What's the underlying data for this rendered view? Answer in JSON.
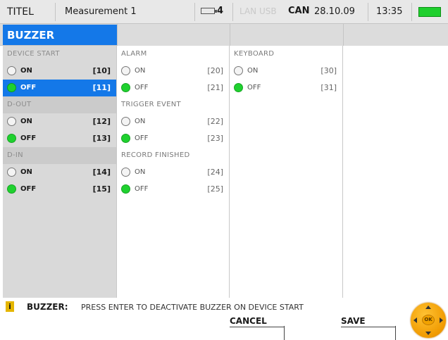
{
  "status_bar": {
    "titel": "TITEL",
    "measurement": "Measurement 1",
    "battery_count": "4",
    "lan_usb": "LAN USB",
    "can": "CAN",
    "date": "28.10.09",
    "time": "13:35"
  },
  "header": {
    "title": "BUZZER"
  },
  "columns": [
    {
      "sections": [
        {
          "title": "DEVICE START",
          "options": [
            {
              "label": "ON",
              "code": "[10]",
              "checked": false
            },
            {
              "label": "OFF",
              "code": "[11]",
              "checked": true,
              "selected": true
            }
          ]
        },
        {
          "title": "D-OUT",
          "options": [
            {
              "label": "ON",
              "code": "[12]",
              "checked": false
            },
            {
              "label": "OFF",
              "code": "[13]",
              "checked": true
            }
          ]
        },
        {
          "title": "D-IN",
          "options": [
            {
              "label": "ON",
              "code": "[14]",
              "checked": false
            },
            {
              "label": "OFF",
              "code": "[15]",
              "checked": true
            }
          ]
        }
      ]
    },
    {
      "sections": [
        {
          "title": "ALARM",
          "options": [
            {
              "label": "ON",
              "code": "[20]",
              "checked": false
            },
            {
              "label": "OFF",
              "code": "[21]",
              "checked": true
            }
          ]
        },
        {
          "title": "TRIGGER EVENT",
          "options": [
            {
              "label": "ON",
              "code": "[22]",
              "checked": false
            },
            {
              "label": "OFF",
              "code": "[23]",
              "checked": true
            }
          ]
        },
        {
          "title": "RECORD FINISHED",
          "options": [
            {
              "label": "ON",
              "code": "[24]",
              "checked": false
            },
            {
              "label": "OFF",
              "code": "[25]",
              "checked": true
            }
          ]
        }
      ]
    },
    {
      "sections": [
        {
          "title": "KEYBOARD",
          "options": [
            {
              "label": "ON",
              "code": "[30]",
              "checked": false
            },
            {
              "label": "OFF",
              "code": "[31]",
              "checked": true
            }
          ]
        }
      ]
    }
  ],
  "hint": {
    "lead": "BUZZER:",
    "text": "PRESS ENTER TO DEACTIVATE BUZZER ON DEVICE START"
  },
  "softkeys": {
    "cancel": "CANCEL",
    "save": "SAVE"
  },
  "okpad": {
    "label": "OK"
  },
  "colors": {
    "selection": "#1478e8",
    "radio_on": "#1fd12f",
    "battery": "#1fcf2d",
    "jog_dial": "#f09a00"
  }
}
